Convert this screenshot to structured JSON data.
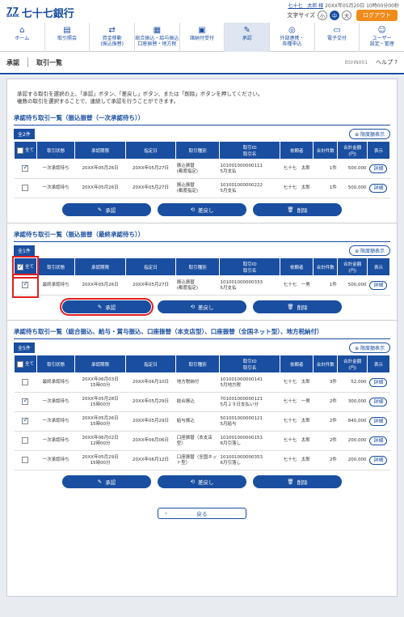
{
  "logo": {
    "mark": "77",
    "sub": "BANK",
    "name": "七十七銀行"
  },
  "user": {
    "name": "七十七　太郎 様",
    "login": "20XX年05月20日 10時00分00秒"
  },
  "font_size_label": "文字サイズ",
  "font_sizes": [
    "小",
    "中",
    "大"
  ],
  "logout": "ログアウト",
  "nav": [
    {
      "icon": "⌂",
      "label": "ホーム"
    },
    {
      "icon": "▤",
      "label": "取引照会"
    },
    {
      "icon": "⇄",
      "label": "資金移動\n(振込振替)"
    },
    {
      "icon": "▦",
      "label": "総合振込・給与振込\n口座振替・地方税"
    },
    {
      "icon": "▣",
      "label": "諸納付受付"
    },
    {
      "icon": "✎",
      "label": "承認"
    },
    {
      "icon": "◎",
      "label": "外部連携・\n各種申込"
    },
    {
      "icon": "▭",
      "label": "電子交付"
    },
    {
      "icon": "☺",
      "label": "ユーザー\n設定・管理"
    }
  ],
  "sub": {
    "a": "承認",
    "b": "取引一覧",
    "code": "BSHN001",
    "help": "ヘルプ"
  },
  "intro": "承認する取引を選択の上、「承認」ボタン、「差戻し」ボタン、または「削除」ボタンを押してください。\n複数の取引を選択することで、連続して承認を行うことができます。",
  "filter": "限度額表示",
  "headers": {
    "all": "全て",
    "status": "取引状態",
    "deadline": "承認期限",
    "date": "指定日",
    "type": "取引種別",
    "id": "取引ID\n取引名",
    "req": "依頼者",
    "cnt": "合計件数",
    "amt": "合計金額\n(円)",
    "view": "表示"
  },
  "buttons": {
    "approve": "承認",
    "remand": "差戻し",
    "delete": "削除"
  },
  "detail": "詳細",
  "sections": [
    {
      "title": "承認待ち取引一覧（振込振替（一次承認待ち））",
      "count": "全2件",
      "all_checked": false,
      "rows": [
        {
          "checked": true,
          "status": "一次承認待ち",
          "deadline": "20XX年05月26日",
          "date": "20XX年05月27日",
          "type": "振込振替\n(都度指定)",
          "id": "101001000000111\n5月支払",
          "req": "七十七　太郎",
          "cnt": "1件",
          "amt": "500,000"
        },
        {
          "checked": false,
          "status": "一次承認待ち",
          "deadline": "20XX年05月26日",
          "date": "20XX年05月27日",
          "type": "振込振替\n(都度指定)",
          "id": "101001000000222\n5月支払",
          "req": "七十七　太郎",
          "cnt": "1件",
          "amt": "500,000"
        }
      ]
    },
    {
      "title": "承認待ち取引一覧（振込振替（最終承認待ち））",
      "count": "全1件",
      "all_checked": true,
      "rows": [
        {
          "checked": true,
          "status": "最終承認待ち",
          "deadline": "20XX年05月26日",
          "date": "20XX年05月27日",
          "type": "振込振替\n(都度指定)",
          "id": "101001000000333\n5月支払",
          "req": "七十七　一男",
          "cnt": "1件",
          "amt": "500,000"
        }
      ]
    },
    {
      "title": "承認待ち取引一覧（総合振込、給与・賞与振込、口座振替（本支店型）、口座振替（全国ネット型）、地方税納付）",
      "count": "全5件",
      "all_checked": false,
      "rows": [
        {
          "checked": false,
          "status": "最終承認待ち",
          "deadline": "20XX年06月03日\n15時00分",
          "date": "20XX年06月10日",
          "type": "地方税納付",
          "id": "101001000000141\n5月地方税",
          "req": "七十七　太郎",
          "cnt": "3件",
          "amt": "52,000"
        },
        {
          "checked": true,
          "status": "一次承認待ち",
          "deadline": "20XX年05月28日\n15時00分",
          "date": "20XX年05月29日",
          "type": "総合振込",
          "id": "701001000000121\n5月２９日支払い分",
          "req": "七十七　一男",
          "cnt": "2件",
          "amt": "300,000"
        },
        {
          "checked": true,
          "status": "一次承認待ち",
          "deadline": "20XX年05月26日\n15時00分",
          "date": "20XX年05月29日",
          "type": "給与振込",
          "id": "501001000000121\n5月給与",
          "req": "七十七　太郎",
          "cnt": "2件",
          "amt": "840,000"
        },
        {
          "checked": false,
          "status": "一次承認待ち",
          "deadline": "20XX年06月02日\n12時00分",
          "date": "20XX年06月06日",
          "type": "口座振替（本支店型）",
          "id": "101001000000151\n6月引落し",
          "req": "七十七　太郎",
          "cnt": "2件",
          "amt": "200,000"
        },
        {
          "checked": false,
          "status": "一次承認待ち",
          "deadline": "20XX年05月29日\n15時00分",
          "date": "20XX年06月12日",
          "type": "口座振替（全国ネット型）",
          "id": "101001000000353\n6月引落し",
          "req": "七十七　太郎",
          "cnt": "2件",
          "amt": "200,000"
        }
      ]
    }
  ],
  "back": "戻る"
}
